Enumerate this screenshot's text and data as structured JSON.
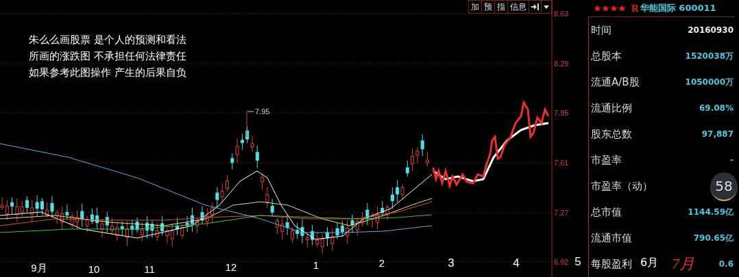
{
  "toolbar": {
    "buttons": [
      "加",
      "预",
      "指",
      "信息"
    ]
  },
  "disclaimer": [
    "朱么么画股票 是个人的预测和看法",
    "所画的涨跌图 不承担任何法律责任",
    "如果参考此图操作 产生的后果自负"
  ],
  "chart": {
    "price_labels": [
      "8.63",
      "8.29",
      "7.95",
      "7.61",
      "7.27",
      "6.92"
    ],
    "peak_label": "7.95",
    "months": [
      {
        "label": "9月",
        "kind": "axis"
      },
      {
        "label": "10",
        "kind": "axis"
      },
      {
        "label": "11",
        "kind": "axis"
      },
      {
        "label": "12",
        "kind": "axis"
      },
      {
        "label": "1",
        "kind": "axis"
      },
      {
        "label": "2",
        "kind": "axis"
      },
      {
        "label": "3",
        "kind": "hand"
      },
      {
        "label": "4",
        "kind": "hand"
      },
      {
        "label": "5",
        "kind": "hand"
      }
    ]
  },
  "panel": {
    "stars": 4,
    "market_mark": "R",
    "title": "华能国际 600011",
    "rows": [
      {
        "label": "时间",
        "value": "20160930",
        "kind": "date"
      },
      {
        "label": "总股本",
        "value": "1520038万",
        "kind": "number"
      },
      {
        "label": "流通A/B股",
        "value": "1050000万",
        "kind": "number"
      },
      {
        "label": "流通比例",
        "value": "69.08%",
        "kind": "number"
      },
      {
        "label": "股东总数",
        "value": "97,887",
        "kind": "number"
      },
      {
        "label": "市盈率",
        "value": "-",
        "kind": "number"
      },
      {
        "label": "市盈率（动）"
      },
      {
        "label": "总市值",
        "value": "1144.59亿",
        "kind": "number"
      },
      {
        "label": "流通市值",
        "value": "790.65亿",
        "kind": "number"
      },
      {
        "label": "每股盈利",
        "value": "0.6",
        "kind": "number"
      }
    ]
  },
  "annotations": [
    {
      "text": "6月",
      "kind": "typed"
    },
    {
      "text": "7月",
      "kind": "hand"
    }
  ],
  "widget": {
    "reading": "58"
  }
}
